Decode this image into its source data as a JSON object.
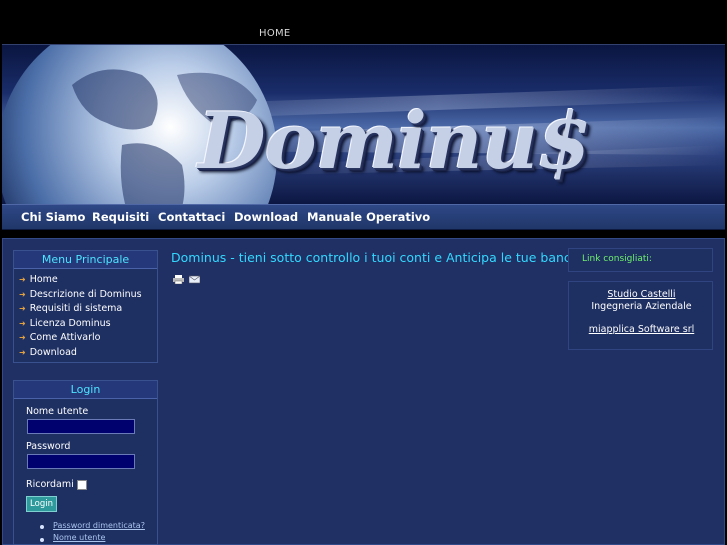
{
  "top_nav": {
    "home": "HOME"
  },
  "banner": {
    "logo": "Dominu$"
  },
  "main_nav": [
    "Chi Siamo",
    "Requisiti",
    "Contattaci",
    "Download",
    "Manuale Operativo"
  ],
  "menu": {
    "title": "Menu Principale",
    "items": [
      "Home",
      "Descrizione di Dominus",
      "Requisiti di sistema",
      "Licenza Dominus",
      "Come Attivarlo",
      "Download"
    ]
  },
  "login": {
    "title": "Login",
    "username_label": "Nome utente",
    "password_label": "Password",
    "remember_label": "Ricordami",
    "button": "Login",
    "links": [
      "Password dimenticata?",
      "Nome utente"
    ]
  },
  "content": {
    "title": "Dominus - tieni sotto controllo i tuoi conti e Anticipa le tue banche"
  },
  "links_panel": {
    "title": "Link consigliati:",
    "studio": "Studio Castelli",
    "studio_sub": "Ingegneria Aziendale",
    "miapplica": "miapplica Software srl"
  },
  "icons": [
    "print-icon",
    "email-icon"
  ]
}
